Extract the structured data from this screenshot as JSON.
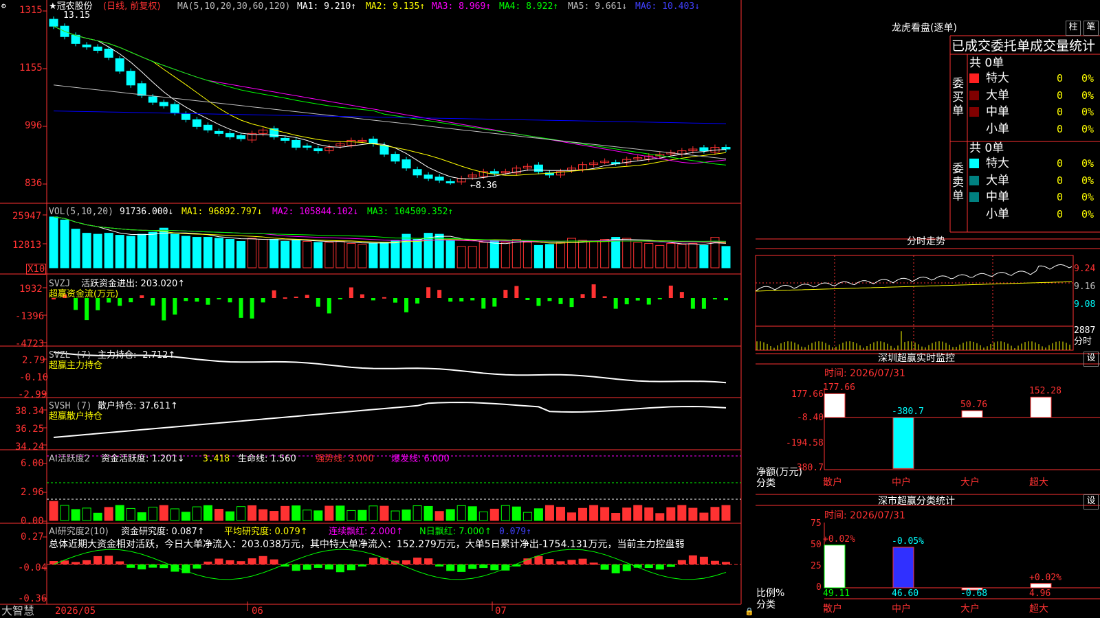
{
  "app": {
    "name": "大智慧"
  },
  "colors": {
    "up": "#ff3232",
    "down": "#00ffff",
    "axis": "#ff3232",
    "ma1": "#ffffff",
    "ma2": "#ffff00",
    "ma3": "#ff00ff",
    "ma4": "#00ff00",
    "ma5": "#c0c0c0",
    "ma6": "#0000ff",
    "white": "#ffffff",
    "yellow": "#ffff00",
    "magenta": "#ff00ff",
    "green": "#00ff00"
  },
  "main_chart": {
    "title": "★冠农股份",
    "mode": "(日线, 前复权)",
    "ma_label": "MA(5,10,20,30,60,120)",
    "ma1": "MA1: 9.210↑",
    "ma2": "MA2: 9.135↑",
    "ma3": "MA3: 8.969↑",
    "ma4": "MA4: 8.922↑",
    "ma5": "MA5: 9.661↓",
    "ma6": "MA6: 10.403↓",
    "high_marker": "13.15",
    "low_marker": "←8.36",
    "y_labels": [
      "1315",
      "1155",
      "996",
      "836"
    ]
  },
  "chart_data": {
    "type": "candlestick",
    "n": 62,
    "closes": [
      12.9,
      12.6,
      12.4,
      12.3,
      12.2,
      12.0,
      11.6,
      11.2,
      10.9,
      10.7,
      10.6,
      10.4,
      10.2,
      10.0,
      9.9,
      9.8,
      9.7,
      9.65,
      9.8,
      9.9,
      9.7,
      9.6,
      9.4,
      9.4,
      9.3,
      9.4,
      9.5,
      9.6,
      9.6,
      9.5,
      9.2,
      9.0,
      8.8,
      8.6,
      8.5,
      8.45,
      8.4,
      8.5,
      8.6,
      8.7,
      8.65,
      8.7,
      8.8,
      8.85,
      8.7,
      8.6,
      8.7,
      8.8,
      8.9,
      8.95,
      9.0,
      8.95,
      9.05,
      9.1,
      9.15,
      9.2,
      9.25,
      9.3,
      9.35,
      9.3,
      9.4,
      9.35
    ],
    "volumes": [
      25000,
      23500,
      19000,
      17000,
      16500,
      17000,
      16000,
      15500,
      16500,
      17500,
      19500,
      16500,
      15500,
      15000,
      15000,
      14500,
      14000,
      13000,
      14500,
      14000,
      14000,
      13000,
      13500,
      13000,
      12500,
      12500,
      13000,
      12000,
      11500,
      12000,
      12500,
      13500,
      16500,
      14000,
      17000,
      16500,
      13500,
      10500,
      10500,
      12500,
      13500,
      12500,
      14000,
      12500,
      11000,
      11500,
      12500,
      14500,
      13500,
      13000,
      14000,
      15000,
      14500,
      12500,
      12000,
      11000,
      12000,
      11500,
      12000,
      11000,
      15000,
      10500
    ],
    "vol_labels": [
      "25947",
      "12813",
      "X10"
    ],
    "svzj_labels": [
      "1932",
      "-1396",
      "-4723"
    ],
    "svzl_labels": [
      "2.79",
      "-0.10",
      "-2.99"
    ],
    "svsh_labels": [
      "38.34",
      "36.25",
      "34.24"
    ],
    "ai1_labels": [
      "6.00",
      "2.96",
      "0.00"
    ],
    "ai2_labels": [
      "0.27",
      "-0.04",
      "-0.36"
    ],
    "x_labels": [
      "2026/05",
      "06",
      "07"
    ]
  },
  "vol_panel": {
    "name": "VOL(5,10,20)",
    "v0": "91736.000↓",
    "ma1": "MA1: 96892.797↓",
    "ma2": "MA2: 105844.102↓",
    "ma3": "MA3: 104509.352↑"
  },
  "svzj_panel": {
    "name": "SVZJ",
    "label": "活跃资金进出: 203.020↑",
    "sub": "超赢资金流(万元)"
  },
  "svzl_panel": {
    "name": "SVZL (7)",
    "label": "主力持仓: -2.712↑",
    "sub": "超赢主力持仓"
  },
  "svsh_panel": {
    "name": "SVSH (7)",
    "label": "散户持仓: 37.611↑",
    "sub": "超赢散户持仓"
  },
  "ai1_panel": {
    "name": "AI活跃度2",
    "a": "资金活跃度: 1.201↓",
    "b": "3.418",
    "c": "生命线: 1.560",
    "d": "强势线: 3.000",
    "e": "爆发线: 6.000"
  },
  "ai2_panel": {
    "name": "AI研究度2(10)",
    "a": "资金研究度: 0.087↑",
    "b": "平均研究度: 0.079↑",
    "c": "连续飘红: 2.000↑",
    "d": "N日飘红: 7.000↑",
    "e": "0.079↑",
    "summary": "总体近期大资金相对活跃，今日大单净流入：203.038万元，其中特大单净流入：152.279万元，大单5日累计净出-1754.131万元，当前主力控盘弱"
  },
  "longhu": {
    "title": "龙虎看盘(逐单)",
    "btn1": "柱",
    "btn2": "笔",
    "tabs": "已成交委托单成交量统计",
    "buy_title": "委买单",
    "sell_title": "委卖单",
    "buy_total": "共 0单",
    "sell_total": "共 0单",
    "buy_rows": [
      {
        "name": "特大",
        "count": "0",
        "pct": "0%"
      },
      {
        "name": "大单",
        "count": "0",
        "pct": "0%"
      },
      {
        "name": "中单",
        "count": "0",
        "pct": "0%"
      },
      {
        "name": "小单",
        "count": "0",
        "pct": "0%"
      }
    ],
    "sell_rows": [
      {
        "name": "特大",
        "count": "0",
        "pct": "0%"
      },
      {
        "name": "大单",
        "count": "0",
        "pct": "0%"
      },
      {
        "name": "中单",
        "count": "0",
        "pct": "0%"
      },
      {
        "name": "小单",
        "count": "0",
        "pct": "0%"
      }
    ]
  },
  "intraday": {
    "title": "分时走势",
    "y_labels": [
      "9.24",
      "9.16",
      "9.08"
    ],
    "vol_label": "2887",
    "sub_label": "分时"
  },
  "monitor": {
    "title": "深圳超赢实时监控",
    "btn": "设",
    "time": "时间: 2026/07/31",
    "y_labels": [
      "177.66",
      "-8.40",
      "-194.58",
      "-380.7"
    ],
    "unit": "净额(万元)",
    "axis_title": "分类",
    "bars": [
      {
        "cat": "散户",
        "value": "177.66"
      },
      {
        "cat": "中户",
        "value": "-380.7"
      },
      {
        "cat": "大户",
        "value": "50.76"
      },
      {
        "cat": "超大",
        "value": "152.28"
      }
    ]
  },
  "classify": {
    "title": "深市超赢分类统计",
    "btn": "设",
    "time": "时间: 2026/07/31",
    "y_labels": [
      "75",
      "50",
      "25",
      "0"
    ],
    "unit": "比例%",
    "axis_title": "分类",
    "bars": [
      {
        "cat": "散户",
        "value": "49.11",
        "delta": "+0.02%"
      },
      {
        "cat": "中户",
        "value": "46.60",
        "delta": "-0.05%"
      },
      {
        "cat": "大户",
        "value": "-0.68",
        "delta": ""
      },
      {
        "cat": "超大",
        "value": "4.96",
        "delta": "+0.02%"
      }
    ]
  }
}
